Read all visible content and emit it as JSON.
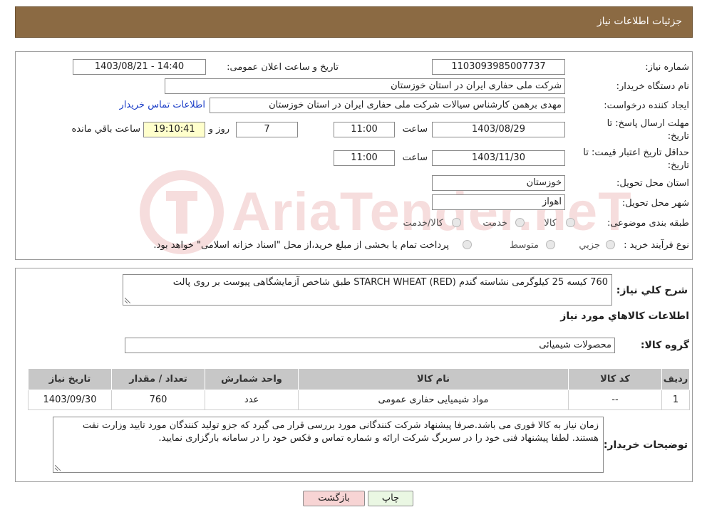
{
  "header": {
    "title": "جزئیات اطلاعات نیاز"
  },
  "form": {
    "need_number": {
      "label": "شماره نیاز:",
      "value": "1103093985007737"
    },
    "announce_datetime": {
      "label": "تاریخ و ساعت اعلان عمومی:",
      "value": "1403/08/21 - 14:40"
    },
    "buyer_org": {
      "label": "نام دستگاه خریدار:",
      "value": "شرکت ملی حفاری ایران در استان خوزستان"
    },
    "requester": {
      "label": "ایجاد کننده درخواست:",
      "value": "مهدی برهمن کارشناس سیالات شرکت ملی حفاری ایران در استان خوزستان",
      "contact_link": "اطلاعات تماس خریدار"
    },
    "reply_deadline": {
      "label_line1": "مهلت ارسال پاسخ: تا",
      "label_line2": "تاریخ:",
      "date": "1403/08/29",
      "time_label": "ساعت",
      "time": "11:00",
      "days": "7",
      "days_label": "روز و",
      "remaining": "19:10:41",
      "remaining_label": "ساعت باقي مانده"
    },
    "price_validity": {
      "label_line1": "حداقل تاریخ اعتبار قیمت: تا",
      "label_line2": "تاریخ:",
      "date": "1403/11/30",
      "time_label": "ساعت",
      "time": "11:00"
    },
    "delivery_province": {
      "label": "استان محل تحویل:",
      "value": "خوزستان"
    },
    "delivery_city": {
      "label": "شهر محل تحویل:",
      "value": "اهواز"
    },
    "category": {
      "label": "طبقه بندی موضوعی:",
      "options": [
        "کالا",
        "خدمت",
        "کالا/خدمت"
      ]
    },
    "purchase_process": {
      "label": "نوع فرآیند خرید :",
      "options": [
        "جزیي",
        "متوسط"
      ],
      "note": "پرداخت تمام یا بخشی از مبلغ خرید،از محل \"اسناد خزانه اسلامی\" خواهد بود."
    }
  },
  "summary": {
    "label": "شرح كلي نياز:",
    "value": "760 کیسه 25 کیلوگرمی نشاسته گندم STARCH WHEAT (RED) طبق شاخص آزمایشگاهی پیوست بر روی پالت"
  },
  "goods_section": {
    "title": "اطلاعات كالاهاي مورد نياز"
  },
  "goods_group": {
    "label": "گروه کالا:",
    "value": "محصولات شیمیائی"
  },
  "table": {
    "columns": [
      "رديف",
      "کد کالا",
      "نام کالا",
      "واحد شمارش",
      "تعداد / مقدار",
      "تاریخ نیاز"
    ],
    "rows": [
      [
        "1",
        "--",
        "مواد شیمیایی حفاری عمومی",
        "عدد",
        "760",
        "1403/09/30"
      ]
    ]
  },
  "buyer_notes": {
    "label": "توضیحات خریدار:",
    "value": "زمان نیاز به کالا فوری می باشد.صرفا پیشنهاد شرکت کنندگانی مورد بررسی قرار می گیرد که جزو تولید کنندگان مورد تایید وزارت نفت هستند. لطفا پیشنهاد فنی خود را در سربرگ شرکت ارائه و شماره تماس و فکس خود را در سامانه بارگزاری نمایید."
  },
  "buttons": {
    "print": "چاپ",
    "back": "بازگشت"
  },
  "watermark": {
    "text": "AriaTender.neT"
  },
  "colors": {
    "header_bg": "#8b6a43",
    "link": "#1a3cc7",
    "back_btn": "#f7d4d4",
    "print_btn": "#eaf7e3"
  }
}
